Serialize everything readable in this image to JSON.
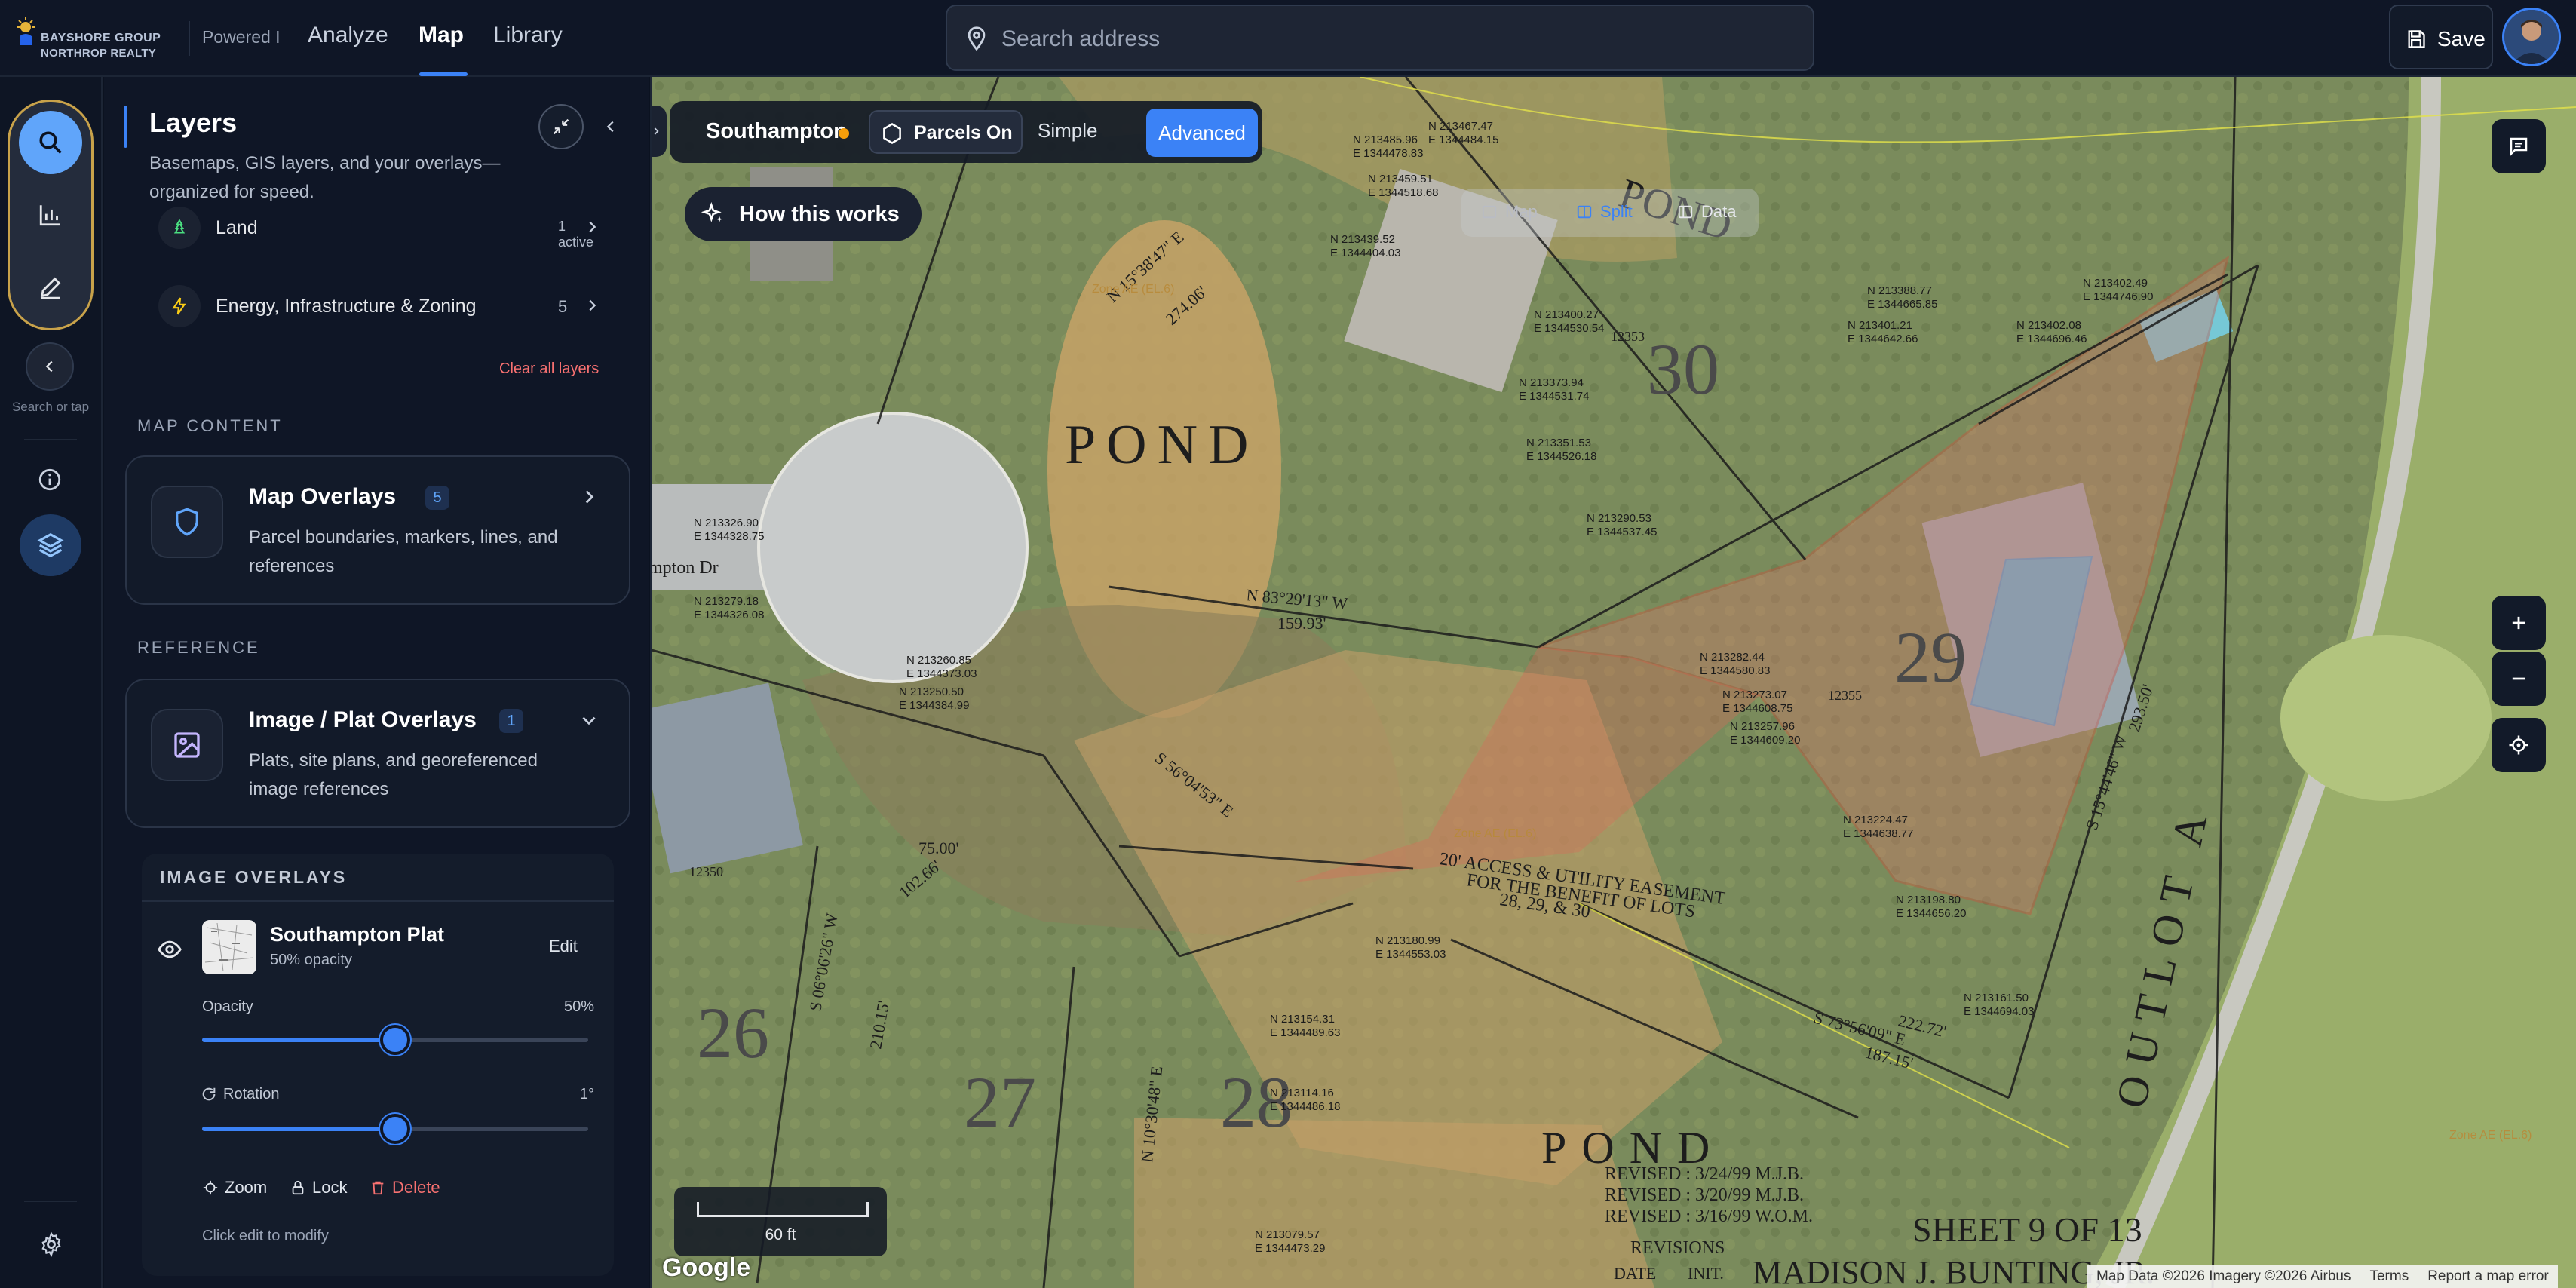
{
  "brand": {
    "logo_line1": "BAYSHORE GROUP",
    "logo_line2": "NORTHROP REALTY",
    "powered": "Powered I"
  },
  "nav": {
    "tabs": [
      "Analyze",
      "Map",
      "Library"
    ],
    "active": "Map"
  },
  "search": {
    "placeholder": "Search address",
    "value": ""
  },
  "header_actions": {
    "save_label": "Save"
  },
  "rail": {
    "hint": "Search or tap"
  },
  "panel": {
    "title": "Layers",
    "subtitle": "Basemaps, GIS layers, and your overlays—organized for speed.",
    "rows": [
      {
        "label": "Land",
        "count": "1 active"
      },
      {
        "label": "Energy, Infrastructure & Zoning",
        "count": "5"
      }
    ],
    "clear_all": "Clear all layers",
    "map_content_label": "MAP CONTENT",
    "map_overlays": {
      "title": "Map Overlays",
      "badge": "5",
      "desc": "Parcel boundaries, markers, lines, and references"
    },
    "reference_label": "REFERENCE",
    "image_overlays_card": {
      "title": "Image / Plat Overlays",
      "badge": "1",
      "desc": "Plats, site plans, and georeferenced image references"
    },
    "image_overlays": {
      "header": "IMAGE OVERLAYS",
      "item": {
        "name": "Southampton Plat",
        "opacity_text": "50% opacity",
        "edit": "Edit"
      },
      "opacity": {
        "label": "Opacity",
        "value_text": "50%",
        "fraction": 0.5
      },
      "rotation": {
        "label": "Rotation",
        "value_text": "1°",
        "fraction": 0.5
      },
      "actions": {
        "zoom": "Zoom",
        "lock": "Lock",
        "delete": "Delete"
      },
      "hint": "Click edit to modify"
    }
  },
  "map": {
    "place": "Southampton",
    "parcels": "Parcels On",
    "modes": {
      "simple": "Simple",
      "advanced": "Advanced"
    },
    "how": "How this works",
    "view_toggle": [
      "Map",
      "Split",
      "Data"
    ],
    "view_active": "Split",
    "scale": "60 ft",
    "google": "Google",
    "attribution": [
      "Map Data ©2026 Imagery ©2026 Airbus",
      "Terms",
      "Report a map error"
    ],
    "plat_text": {
      "pond": "POND",
      "outlot": "OUTLOT A",
      "easement": "20' ACCESS & UTILITY EASEMENT",
      "easement2": "FOR THE BENEFIT OF LOTS",
      "easement3": "28, 29, & 30",
      "sheet": "SHEET 9 OF 13",
      "revisions": "REVISIONS",
      "rev1": "REVISED : 3/24/99 M.J.B.",
      "rev2": "REVISED : 3/20/99 M.J.B.",
      "rev3": "REVISED : 3/16/99 W.O.M.",
      "date": "DATE",
      "init": "INIT.",
      "madison": "MADISON J. BUNTING, JR.",
      "lots": [
        "26",
        "27",
        "28",
        "29",
        "30"
      ],
      "street": "mpton Dr",
      "addr1": "12350",
      "addr2": "12353",
      "addr3": "12355",
      "bearing1": "N 83°29'13\" W",
      "dist1": "159.93'",
      "bearing2": "S 56°04'53\" E",
      "bearing3": "S 73°56'09\" E",
      "dist3": "222.72'",
      "dist4": "187.15'",
      "bearing4": "S 15°44'46\" W",
      "dist5": "293.50'",
      "bearing5": "N 15°38'47\" E",
      "dist6": "274.06'",
      "dist7": "75.00'",
      "dist8": "102.66'",
      "dist9": "210.15'",
      "bearing6": "S 06°06'26\" W",
      "bearing7": "N 10°30'48\" E",
      "zone": "Zone AE (EL.6)",
      "coords": [
        "N 213485.96",
        "E 1344478.83",
        "N 213467.47",
        "E 1344484.15",
        "N 213459.51",
        "E 1344518.68",
        "N 213439.52",
        "E 1344404.03",
        "N 213400.27",
        "E 1344530.54",
        "N 213351.53",
        "E 1344526.18",
        "N 213373.94",
        "E 1344531.74",
        "N 213290.53",
        "E 1344537.45",
        "N 213282.44",
        "E 1344580.83",
        "N 213273.07",
        "E 1344608.75",
        "N 213257.96",
        "E 1344609.20",
        "N 213224.47",
        "E 1344638.77",
        "N 213198.80",
        "E 1344656.20",
        "N 213161.50",
        "E 1344694.03",
        "N 213180.99",
        "E 1344553.03",
        "N 213154.31",
        "E 1344489.63",
        "N 213114.16",
        "E 1344486.18",
        "N 213079.57",
        "E 1344473.29",
        "N 213260.85",
        "E 1344373.03",
        "N 213250.50",
        "E 1344384.99",
        "N 213279.18",
        "E 1344326.08",
        "N 213326.90",
        "E 1344328.75",
        "N 213401.21",
        "E 1344642.66",
        "N 213402.08",
        "E 1344696.46",
        "N 213388.77",
        "E 1344665.85",
        "N 213402.49",
        "E 1344746.90"
      ]
    }
  },
  "colors": {
    "accent": "#3b82f6",
    "danger": "#f87171",
    "rail_outline": "#c8a24a",
    "status_dot": "#f59e0b"
  }
}
